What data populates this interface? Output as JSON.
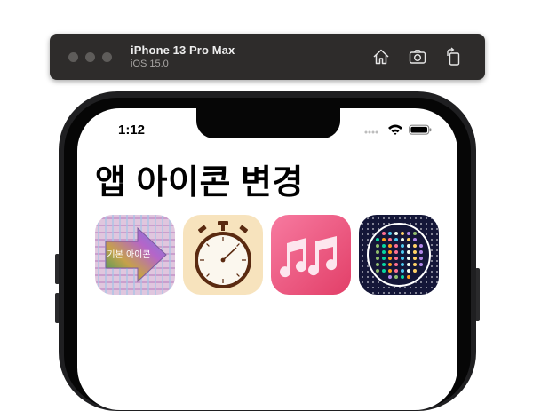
{
  "simulator": {
    "device_name": "iPhone 13 Pro Max",
    "os_version": "iOS 15.0",
    "toolbar": [
      "home-icon",
      "screenshot-icon",
      "rotate-icon"
    ]
  },
  "status_bar": {
    "time": "1:12",
    "icons": [
      "signal-dots-icon",
      "wifi-icon",
      "battery-icon"
    ]
  },
  "page": {
    "title": "앱 아이콘 변경"
  },
  "app_icons": [
    {
      "name": "default-icon",
      "label": "기본 아이콘",
      "colors": [
        "#d9b6d8",
        "#3fa36a",
        "#a56fd6"
      ]
    },
    {
      "name": "stopwatch-icon",
      "colors": [
        "#f7e3bd",
        "#5a2a10"
      ]
    },
    {
      "name": "music-notes-icon",
      "colors": [
        "#f35d8c",
        "#e8486e"
      ]
    },
    {
      "name": "dots-icon",
      "colors": [
        "#141638",
        "#ffffff"
      ]
    }
  ]
}
